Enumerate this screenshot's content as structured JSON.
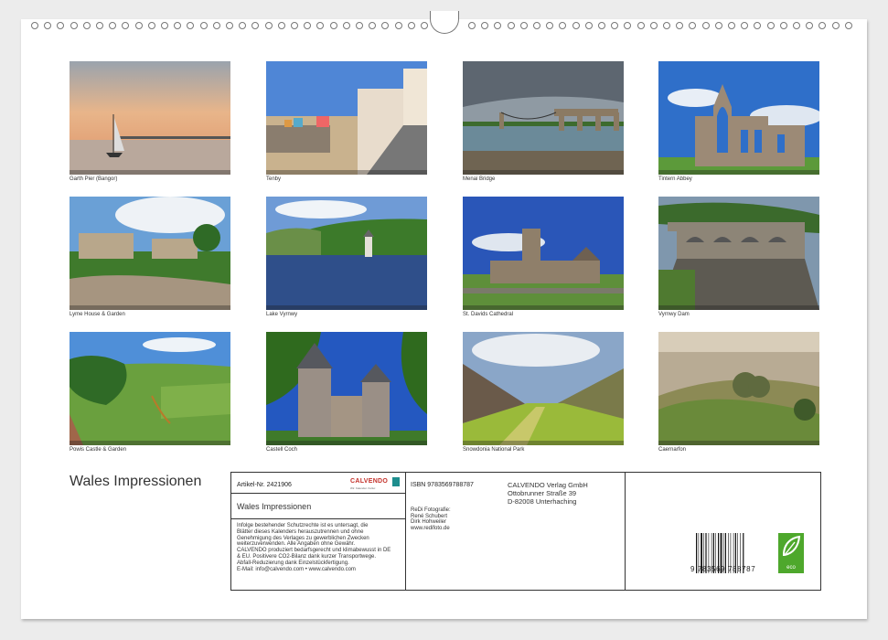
{
  "photos": [
    {
      "caption": "Garth Pier (Bangor)",
      "scene": "harbour-sunset"
    },
    {
      "caption": "Tenby",
      "scene": "seaside-town"
    },
    {
      "caption": "Menai Bridge",
      "scene": "suspension-bridge"
    },
    {
      "caption": "Tintern Abbey",
      "scene": "abbey-ruin"
    },
    {
      "caption": "Lyme House & Garden",
      "scene": "manor-garden"
    },
    {
      "caption": "Lake Vyrnwy",
      "scene": "lake-tower"
    },
    {
      "caption": "St. Davids Cathedral",
      "scene": "cathedral"
    },
    {
      "caption": "Vyrnwy Dam",
      "scene": "dam"
    },
    {
      "caption": "Powis Castle & Garden",
      "scene": "castle-garden"
    },
    {
      "caption": "Castell Coch",
      "scene": "fairytale-castle"
    },
    {
      "caption": "Snowdonia National Park",
      "scene": "valley"
    },
    {
      "caption": "Caernarfon",
      "scene": "misty-fields"
    }
  ],
  "title": "Wales Impressionen",
  "infobox": {
    "artikel_nr": "Artikel-Nr. 2421906",
    "logo_text": "CALVENDO",
    "logo_sub": "Wir. Kalender. Kultur.",
    "calendar_title": "Wales Impressionen",
    "legal_lines": [
      "Infolge bestehender Schutzrechte ist es untersagt, die",
      "Blätter dieses Kalenders herauszutrennen und ohne",
      "Genehmigung des Verlages zu gewerblichen Zwecken",
      "weiterzuverwenden. Alle Angaben ohne Gewähr.",
      "CALVENDO produziert bedarfsgerecht und klimabewusst in DE",
      "& EU. Positivere CO2-Bilanz dank kurzer Transportwege.",
      "Abfall-Reduzierung dank Einzelstückfertigung.",
      "E-Mail: info@calvendo.com • www.calvendo.com"
    ],
    "isbn": "ISBN 9783569788787",
    "credits_lines": [
      "ReDi Fotografie:",
      "René Schubert",
      "Dirk Hohweiler",
      "www.redifoto.de"
    ],
    "publisher_lines": [
      "CALVENDO Verlag GmbH",
      "Ottobrunner Straße 39",
      "D-82008 Unterhaching"
    ],
    "barcode_number": "9 783569 788787",
    "eco_label": "eco"
  },
  "colors": {
    "eco_green": "#4ea82c",
    "logo_red": "#c4322b",
    "logo_teal": "#1e8e8e"
  }
}
